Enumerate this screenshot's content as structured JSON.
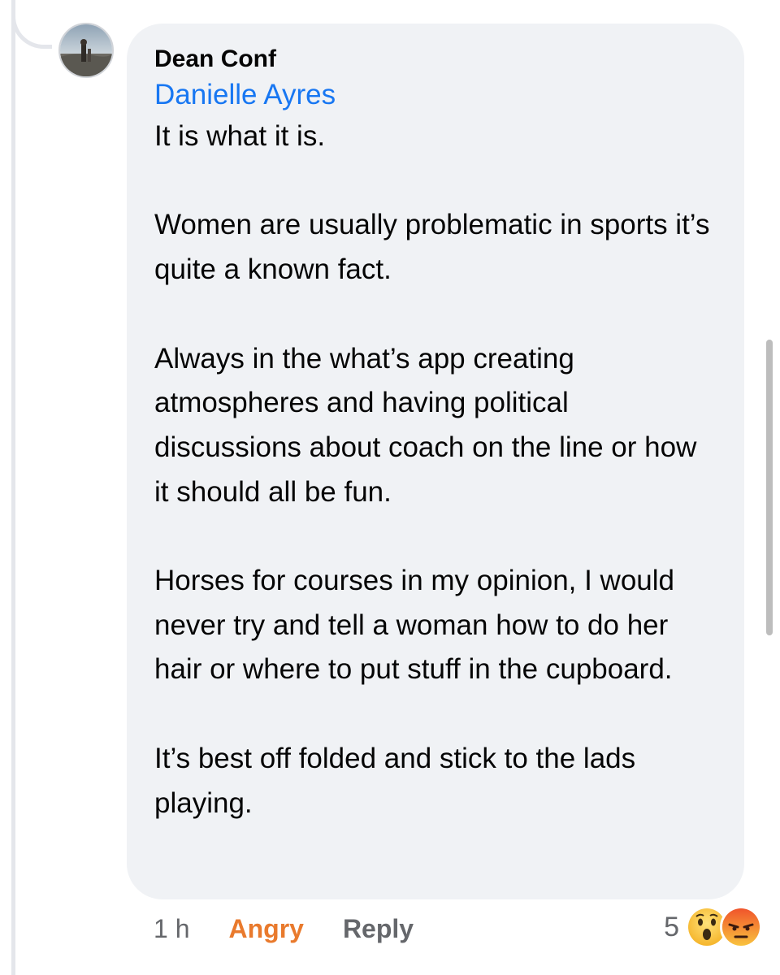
{
  "comment": {
    "author": "Dean Conf",
    "mention": "Danielle Ayres",
    "text": "It is what it is.\n\nWomen are usually problematic in sports it’s quite a known fact.\n\nAlways in the what’s app creating atmospheres and having political discussions about coach on the line or how it should all be fun.\n\nHorses for courses in my opinion, I would never try and tell a woman how to do her hair or where to put stuff in the cupboard.\n\nIt’s best off folded and stick to the lads playing."
  },
  "actions": {
    "time": "1 h",
    "reaction_label": "Angry",
    "reply_label": "Reply"
  },
  "reactions": {
    "count": "5",
    "icons": [
      "wow-emoji-icon",
      "angry-emoji-icon"
    ]
  },
  "colors": {
    "bubble": "#f0f2f5",
    "mention": "#1877f2",
    "angry": "#e97a2d",
    "meta": "#65676b"
  }
}
